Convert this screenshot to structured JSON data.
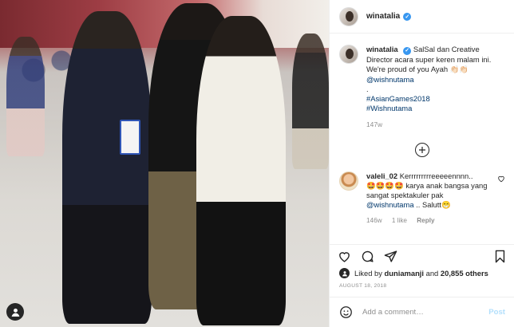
{
  "post": {
    "username": "winatalia",
    "verified": true,
    "caption": {
      "username": "winatalia",
      "text_1": "SalSal dan Creative Director acara super keren malam ini. We're proud of you Ayah",
      "mention": "@wishnutama",
      "emoji": "👏🏻👏🏻",
      "dot": ".",
      "hashtag_1": "#AsianGames2018",
      "hashtag_2": "#Wishnutama",
      "age": "147w"
    },
    "comments": [
      {
        "username": "valeli_02",
        "text_1": "Kerrrrrrrrreeeeennnn..",
        "emoji": "🤩🤩🤩🤩",
        "text_2": "karya anak bangsa yang sangat spektakuler pak",
        "mention": "@wishnutama",
        "text_3": ".. Salutt😁",
        "age": "146w",
        "likes": "1 like",
        "reply": "Reply"
      }
    ],
    "likes": {
      "prefix": "Liked by",
      "by_user": "duniamanji",
      "and": "and",
      "others": "20,855 others"
    },
    "date": "AUGUST 18, 2018",
    "add_comment": {
      "placeholder": "Add a comment…",
      "post_label": "Post"
    }
  },
  "icons": {
    "heart": "heart-icon",
    "comment": "comment-icon",
    "share": "share-icon",
    "bookmark": "bookmark-icon",
    "emoji": "emoji-icon",
    "load_more": "plus-circle-icon",
    "user": "user-icon"
  },
  "colors": {
    "verified": "#3897f0",
    "link": "#00376b",
    "muted": "#8e8e8e",
    "post_disabled": "#b2dffc"
  }
}
